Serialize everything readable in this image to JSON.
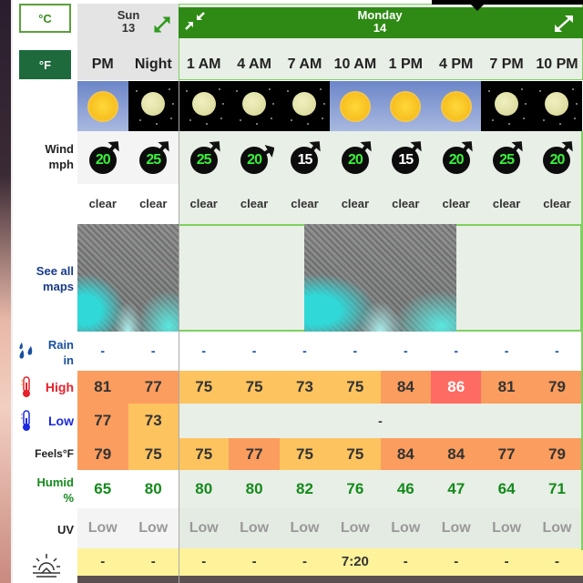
{
  "units": {
    "celsius_label": "°C",
    "fahrenheit_label": "°F",
    "selected": "°F"
  },
  "days": [
    {
      "name": "Sun",
      "date": "13",
      "expand_icon": "expand-icon"
    },
    {
      "name": "Monday",
      "date": "14",
      "collapse_icon": "collapse-icon",
      "expand_icon": "expand-icon"
    }
  ],
  "labels": {
    "wind": "Wind",
    "wind_unit": "mph",
    "see_all_maps_1": "See all",
    "see_all_maps_2": "maps",
    "rain": "Rain",
    "rain_unit": "in",
    "high": "High",
    "low": "Low",
    "feels": "Feels°F",
    "humid": "Humid",
    "humid_unit": "%",
    "uv": "UV",
    "sunrise_icon": "sunrise-icon",
    "rain_icon": "raindrops-icon",
    "high_icon": "thermometer-hot-icon",
    "low_icon": "thermometer-cold-icon"
  },
  "columns": [
    {
      "time": "PM",
      "sky": "sun",
      "wind": "20",
      "wind_dir": "N",
      "summary": "clear",
      "rain": "-",
      "high": "81",
      "low": "77",
      "feels": "79",
      "humid": "65",
      "uv": "Low",
      "sunrise": "-"
    },
    {
      "time": "Night",
      "sky": "moon",
      "wind": "25",
      "wind_dir": "NE",
      "summary": "clear",
      "rain": "-",
      "high": "77",
      "low": "73",
      "feels": "75",
      "humid": "80",
      "uv": "Low",
      "sunrise": "-"
    },
    {
      "time": "1 AM",
      "sky": "moon",
      "wind": "25",
      "wind_dir": "NE",
      "summary": "clear",
      "rain": "-",
      "high": "75",
      "low": "",
      "feels": "75",
      "humid": "80",
      "uv": "Low",
      "sunrise": "-"
    },
    {
      "time": "4 AM",
      "sky": "moon",
      "wind": "20",
      "wind_dir": "ENE",
      "summary": "clear",
      "rain": "-",
      "high": "75",
      "low": "",
      "feels": "77",
      "humid": "80",
      "uv": "Low",
      "sunrise": "-"
    },
    {
      "time": "7 AM",
      "sky": "moon",
      "wind": "15",
      "wind_dir": "NE",
      "summary": "clear",
      "rain": "-",
      "high": "73",
      "low": "",
      "feels": "75",
      "humid": "82",
      "uv": "Low",
      "sunrise": "-"
    },
    {
      "time": "10 AM",
      "sky": "sun",
      "wind": "20",
      "wind_dir": "NE",
      "summary": "clear",
      "rain": "-",
      "high": "75",
      "low": "",
      "feels": "75",
      "humid": "76",
      "uv": "Low",
      "sunrise": "7:20"
    },
    {
      "time": "1 PM",
      "sky": "sun",
      "wind": "15",
      "wind_dir": "NE",
      "summary": "clear",
      "rain": "-",
      "high": "84",
      "low": "",
      "feels": "84",
      "humid": "46",
      "uv": "Low",
      "sunrise": "-"
    },
    {
      "time": "4 PM",
      "sky": "sun",
      "wind": "20",
      "wind_dir": "NE",
      "summary": "clear",
      "rain": "-",
      "high": "86",
      "low": "",
      "feels": "84",
      "humid": "47",
      "uv": "Low",
      "sunrise": "-"
    },
    {
      "time": "7 PM",
      "sky": "moon",
      "wind": "25",
      "wind_dir": "NE",
      "summary": "clear",
      "rain": "-",
      "high": "81",
      "low": "",
      "feels": "77",
      "humid": "64",
      "uv": "Low",
      "sunrise": "-"
    },
    {
      "time": "10 PM",
      "sky": "moon",
      "wind": "20",
      "wind_dir": "NE",
      "summary": "clear",
      "rain": "-",
      "high": "79",
      "low": "",
      "feels": "79",
      "humid": "71",
      "uv": "Low",
      "sunrise": "-"
    }
  ],
  "monday_low_placeholder": "-",
  "colors": {
    "header_green": "#2e8a14",
    "unit_selected": "#1e6a3c",
    "humid_green": "#148a1c",
    "temp_orange": "#fb9d5e",
    "temp_yellow": "#fdc35f",
    "temp_red": "#fe6b62",
    "sunrise_yellow": "#fef39a",
    "rain_blue": "#1a4fa0",
    "high_red": "#e8202a",
    "low_blue": "#1a2ae0"
  }
}
